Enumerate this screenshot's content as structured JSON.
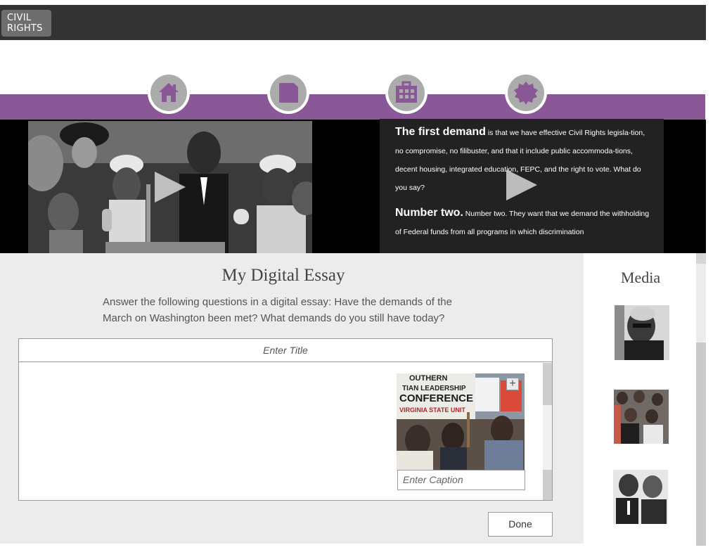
{
  "app": {
    "logo_line1": "CIVIL",
    "logo_line2": "RIGHTS"
  },
  "nav": [
    {
      "icon": "home-icon"
    },
    {
      "icon": "document-icon"
    },
    {
      "icon": "briefcase-icon"
    },
    {
      "icon": "badge-icon"
    }
  ],
  "transcript": {
    "p1_heading": "The first demand",
    "p1_text": " is that we have effective Civil Rights legisla-tion, no compromise, no filibuster, and that it include public accommoda-tions, decent housing, integrated education, FEPC, and the right to vote. What do you say?",
    "p2_heading": "Number two.",
    "p2_text": " Number two. They want that we demand the withholding of Federal funds from all programs in which discrimination"
  },
  "essay": {
    "title": "My Digital Essay",
    "prompt": "Answer the following questions in a digital essay:  Have the demands of the March on Washington been met? What demands do you still have today?",
    "title_placeholder": "Enter Title",
    "caption_placeholder": "Enter Caption",
    "embed_sign_lines": [
      "OUTHERN",
      "TIAN LEADERSHIP",
      "CONFERENCE",
      "VIRGINIA STATE UNIT"
    ],
    "done_label": "Done"
  },
  "media": {
    "title": "Media"
  },
  "colors": {
    "accent": "#8a5896",
    "topbar": "#333333",
    "nav_circle": "#ababab"
  }
}
